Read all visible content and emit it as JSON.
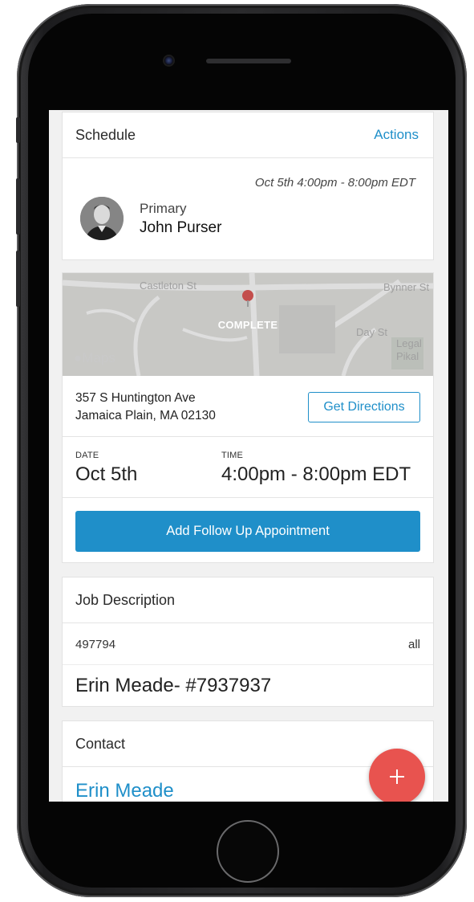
{
  "schedule": {
    "title": "Schedule",
    "actions_label": "Actions",
    "time_range": "Oct 5th 4:00pm - 8:00pm EDT",
    "role": "Primary",
    "assignee": "John Purser"
  },
  "map": {
    "status": "COMPLETE",
    "provider": "Maps",
    "streets": [
      "Castleton St",
      "Bynner St",
      "Day St",
      "Legal",
      "Pikal"
    ]
  },
  "location": {
    "address_line1": "357 S Huntington Ave",
    "address_line2": "Jamaica Plain, MA 02130",
    "directions_label": "Get Directions"
  },
  "datetime": {
    "date_label": "DATE",
    "date_value": "Oct 5th",
    "time_label": "TIME",
    "time_value": "4:00pm - 8:00pm EDT"
  },
  "follow_up": {
    "label": "Add Follow Up Appointment"
  },
  "job": {
    "title": "Job Description",
    "id": "497794",
    "scope": "all",
    "description": "Erin Meade- #7937937"
  },
  "contact": {
    "title": "Contact",
    "name": "Erin Meade"
  },
  "fab": {
    "icon": "plus-icon"
  },
  "colors": {
    "accent": "#1f8fc9",
    "fab": "#e8534f",
    "pin": "#e05a58"
  }
}
